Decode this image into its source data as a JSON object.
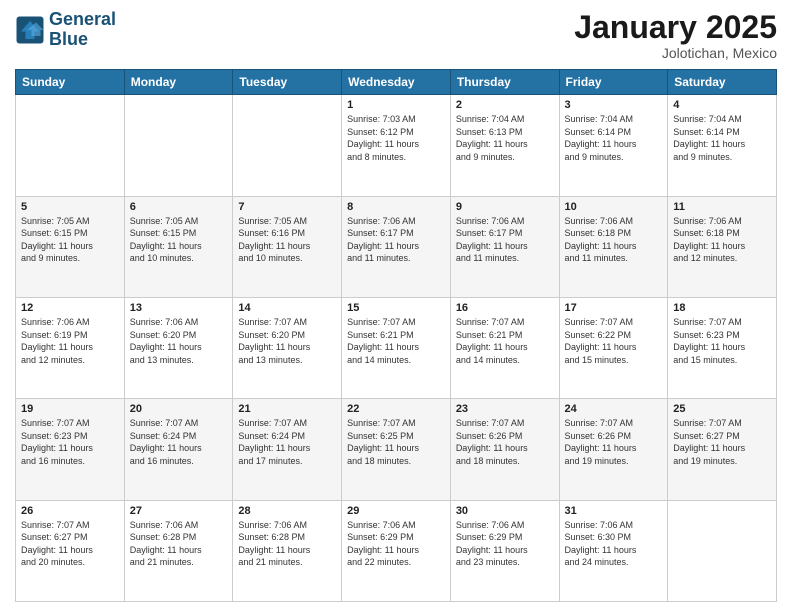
{
  "header": {
    "logo_line1": "General",
    "logo_line2": "Blue",
    "month": "January 2025",
    "location": "Jolotichan, Mexico"
  },
  "days_of_week": [
    "Sunday",
    "Monday",
    "Tuesday",
    "Wednesday",
    "Thursday",
    "Friday",
    "Saturday"
  ],
  "weeks": [
    [
      {
        "day": "",
        "info": ""
      },
      {
        "day": "",
        "info": ""
      },
      {
        "day": "",
        "info": ""
      },
      {
        "day": "1",
        "info": "Sunrise: 7:03 AM\nSunset: 6:12 PM\nDaylight: 11 hours\nand 8 minutes."
      },
      {
        "day": "2",
        "info": "Sunrise: 7:04 AM\nSunset: 6:13 PM\nDaylight: 11 hours\nand 9 minutes."
      },
      {
        "day": "3",
        "info": "Sunrise: 7:04 AM\nSunset: 6:14 PM\nDaylight: 11 hours\nand 9 minutes."
      },
      {
        "day": "4",
        "info": "Sunrise: 7:04 AM\nSunset: 6:14 PM\nDaylight: 11 hours\nand 9 minutes."
      }
    ],
    [
      {
        "day": "5",
        "info": "Sunrise: 7:05 AM\nSunset: 6:15 PM\nDaylight: 11 hours\nand 9 minutes."
      },
      {
        "day": "6",
        "info": "Sunrise: 7:05 AM\nSunset: 6:15 PM\nDaylight: 11 hours\nand 10 minutes."
      },
      {
        "day": "7",
        "info": "Sunrise: 7:05 AM\nSunset: 6:16 PM\nDaylight: 11 hours\nand 10 minutes."
      },
      {
        "day": "8",
        "info": "Sunrise: 7:06 AM\nSunset: 6:17 PM\nDaylight: 11 hours\nand 11 minutes."
      },
      {
        "day": "9",
        "info": "Sunrise: 7:06 AM\nSunset: 6:17 PM\nDaylight: 11 hours\nand 11 minutes."
      },
      {
        "day": "10",
        "info": "Sunrise: 7:06 AM\nSunset: 6:18 PM\nDaylight: 11 hours\nand 11 minutes."
      },
      {
        "day": "11",
        "info": "Sunrise: 7:06 AM\nSunset: 6:18 PM\nDaylight: 11 hours\nand 12 minutes."
      }
    ],
    [
      {
        "day": "12",
        "info": "Sunrise: 7:06 AM\nSunset: 6:19 PM\nDaylight: 11 hours\nand 12 minutes."
      },
      {
        "day": "13",
        "info": "Sunrise: 7:06 AM\nSunset: 6:20 PM\nDaylight: 11 hours\nand 13 minutes."
      },
      {
        "day": "14",
        "info": "Sunrise: 7:07 AM\nSunset: 6:20 PM\nDaylight: 11 hours\nand 13 minutes."
      },
      {
        "day": "15",
        "info": "Sunrise: 7:07 AM\nSunset: 6:21 PM\nDaylight: 11 hours\nand 14 minutes."
      },
      {
        "day": "16",
        "info": "Sunrise: 7:07 AM\nSunset: 6:21 PM\nDaylight: 11 hours\nand 14 minutes."
      },
      {
        "day": "17",
        "info": "Sunrise: 7:07 AM\nSunset: 6:22 PM\nDaylight: 11 hours\nand 15 minutes."
      },
      {
        "day": "18",
        "info": "Sunrise: 7:07 AM\nSunset: 6:23 PM\nDaylight: 11 hours\nand 15 minutes."
      }
    ],
    [
      {
        "day": "19",
        "info": "Sunrise: 7:07 AM\nSunset: 6:23 PM\nDaylight: 11 hours\nand 16 minutes."
      },
      {
        "day": "20",
        "info": "Sunrise: 7:07 AM\nSunset: 6:24 PM\nDaylight: 11 hours\nand 16 minutes."
      },
      {
        "day": "21",
        "info": "Sunrise: 7:07 AM\nSunset: 6:24 PM\nDaylight: 11 hours\nand 17 minutes."
      },
      {
        "day": "22",
        "info": "Sunrise: 7:07 AM\nSunset: 6:25 PM\nDaylight: 11 hours\nand 18 minutes."
      },
      {
        "day": "23",
        "info": "Sunrise: 7:07 AM\nSunset: 6:26 PM\nDaylight: 11 hours\nand 18 minutes."
      },
      {
        "day": "24",
        "info": "Sunrise: 7:07 AM\nSunset: 6:26 PM\nDaylight: 11 hours\nand 19 minutes."
      },
      {
        "day": "25",
        "info": "Sunrise: 7:07 AM\nSunset: 6:27 PM\nDaylight: 11 hours\nand 19 minutes."
      }
    ],
    [
      {
        "day": "26",
        "info": "Sunrise: 7:07 AM\nSunset: 6:27 PM\nDaylight: 11 hours\nand 20 minutes."
      },
      {
        "day": "27",
        "info": "Sunrise: 7:06 AM\nSunset: 6:28 PM\nDaylight: 11 hours\nand 21 minutes."
      },
      {
        "day": "28",
        "info": "Sunrise: 7:06 AM\nSunset: 6:28 PM\nDaylight: 11 hours\nand 21 minutes."
      },
      {
        "day": "29",
        "info": "Sunrise: 7:06 AM\nSunset: 6:29 PM\nDaylight: 11 hours\nand 22 minutes."
      },
      {
        "day": "30",
        "info": "Sunrise: 7:06 AM\nSunset: 6:29 PM\nDaylight: 11 hours\nand 23 minutes."
      },
      {
        "day": "31",
        "info": "Sunrise: 7:06 AM\nSunset: 6:30 PM\nDaylight: 11 hours\nand 24 minutes."
      },
      {
        "day": "",
        "info": ""
      }
    ]
  ]
}
